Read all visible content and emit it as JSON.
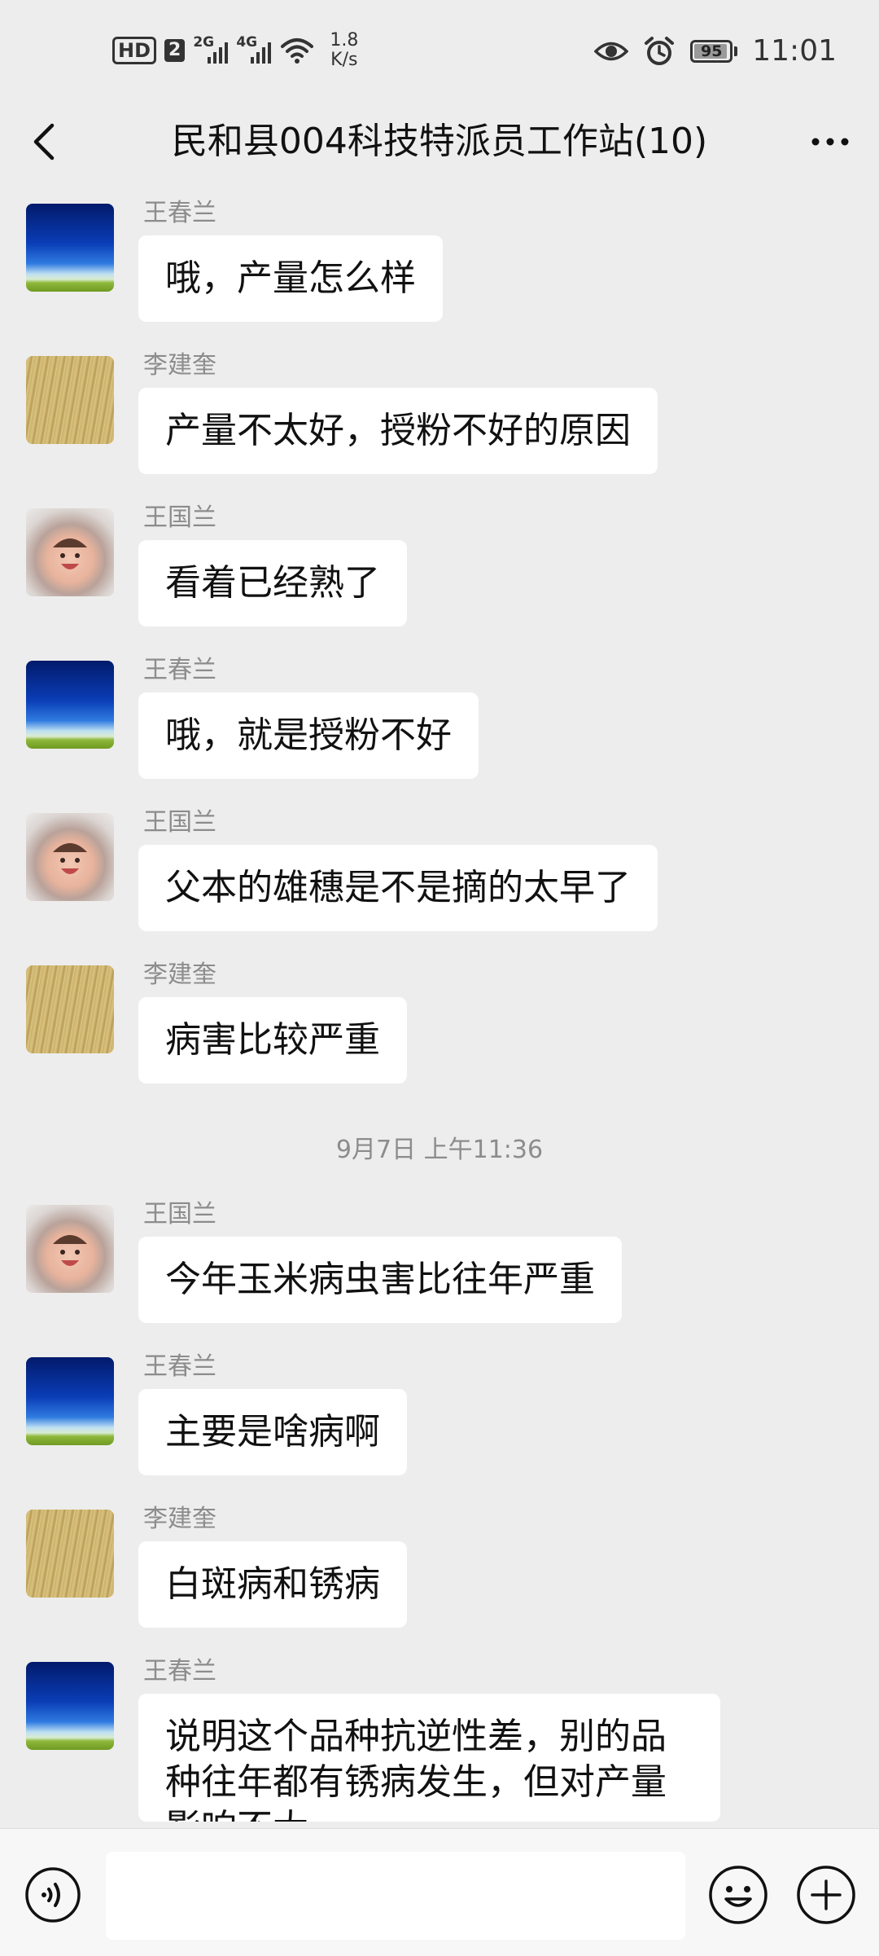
{
  "status_bar": {
    "hd": "HD",
    "sim": "2",
    "net1": "2G",
    "net2": "4G",
    "speed_value": "1.8",
    "speed_unit": "K/s",
    "battery": "95",
    "battery_level": 0.95,
    "time": "11:01"
  },
  "header": {
    "title": "民和县004科技特派员工作站(10)"
  },
  "timestamp": "9月7日 上午11:36",
  "messages": [
    {
      "sender": "王春兰",
      "text": "哦，产量怎么样",
      "avatar": "sky-avatar"
    },
    {
      "sender": "李建奎",
      "text": "产量不太好，授粉不好的原因",
      "avatar": "wheat-avatar"
    },
    {
      "sender": "王国兰",
      "text": "看着已经熟了",
      "avatar": "baby-avatar"
    },
    {
      "sender": "王春兰",
      "text": "哦，就是授粉不好",
      "avatar": "sky-avatar"
    },
    {
      "sender": "王国兰",
      "text": "父本的雄穗是不是摘的太早了",
      "avatar": "baby-avatar"
    },
    {
      "sender": "李建奎",
      "text": "病害比较严重",
      "avatar": "wheat-avatar"
    },
    {
      "sender": "王国兰",
      "text": "今年玉米病虫害比往年严重",
      "avatar": "baby-avatar"
    },
    {
      "sender": "王春兰",
      "text": "主要是啥病啊",
      "avatar": "sky-avatar"
    },
    {
      "sender": "李建奎",
      "text": "白斑病和锈病",
      "avatar": "wheat-avatar"
    },
    {
      "sender": "王春兰",
      "text": "说明这个品种抗逆性差，别的品种往年都有锈病发生，但对产量影响不大",
      "avatar": "sky-avatar"
    }
  ],
  "icons": {
    "back": "back-arrow-icon",
    "more": "more-dots-icon",
    "voice": "voice-icon",
    "emoji": "emoji-icon",
    "plus": "plus-icon"
  },
  "colors": {
    "background": "#ededed",
    "bubble": "#ffffff",
    "sender_text": "#8c8c8c"
  }
}
